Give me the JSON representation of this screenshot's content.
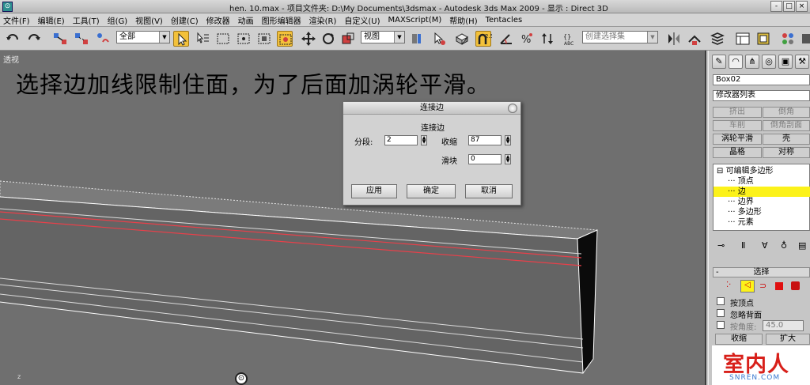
{
  "window": {
    "title": "hen. 10.max    - 项目文件夹: D:\\My Documents\\3dsmax    - Autodesk 3ds Max  2009     - 显示 : Direct 3D",
    "app_icon": "3ds-max-icon",
    "controls": [
      "-",
      "□",
      "×"
    ]
  },
  "menu": [
    "文件(F)",
    "编辑(E)",
    "工具(T)",
    "组(G)",
    "视图(V)",
    "创建(C)",
    "修改器",
    "动画",
    "图形编辑器",
    "渲染(R)",
    "自定义(U)",
    "MAXScript(M)",
    "帮助(H)",
    "Tentacles"
  ],
  "toolbar": {
    "selection_filter": "全部",
    "ref_coord": "视图",
    "named_selection_placeholder": "创建选择集",
    "snap_label": "2.5"
  },
  "viewport": {
    "label": "透视",
    "caption": "选择边加线限制住面，为了后面加涡轮平滑。",
    "axis_label": "z"
  },
  "dialog": {
    "title": "连接边",
    "group_title": "连接边",
    "segments_label": "分段:",
    "segments_value": "2",
    "pinch_label": "收缩",
    "pinch_value": "87",
    "slide_label": "滑块",
    "slide_value": "0",
    "apply_label": "应用",
    "ok_label": "确定",
    "cancel_label": "取消"
  },
  "command_panel": {
    "object_name": "Box02",
    "modifier_list": "修改器列表",
    "buttons": [
      {
        "label": "挤出",
        "enabled": false
      },
      {
        "label": "倒角",
        "enabled": false
      },
      {
        "label": "车削",
        "enabled": false
      },
      {
        "label": "倒角剖面",
        "enabled": false
      },
      {
        "label": "涡轮平滑",
        "enabled": true
      },
      {
        "label": "壳",
        "enabled": true
      },
      {
        "label": "晶格",
        "enabled": true
      },
      {
        "label": "对称",
        "enabled": true
      }
    ],
    "stack": [
      {
        "label": "可编辑多边形",
        "selected": false
      },
      {
        "label": "顶点",
        "selected": false
      },
      {
        "label": "边",
        "selected": true
      },
      {
        "label": "边界",
        "selected": false
      },
      {
        "label": "多边形",
        "selected": false
      },
      {
        "label": "元素",
        "selected": false
      }
    ],
    "selection_rollout": {
      "title": "选择",
      "by_vertex": "按顶点",
      "ignore_backfacing": "忽略背面",
      "by_angle": "按角度:",
      "angle_value": "45.0",
      "shrink": "收缩",
      "grow": "扩大"
    }
  },
  "watermark": {
    "text_cn": "室内人",
    "text_en": "SNREN.COM"
  },
  "colors": {
    "selected_highlight": "#fcf21a",
    "edge_red": "#e8404a",
    "viewport_bg": "#6f6f6f"
  }
}
